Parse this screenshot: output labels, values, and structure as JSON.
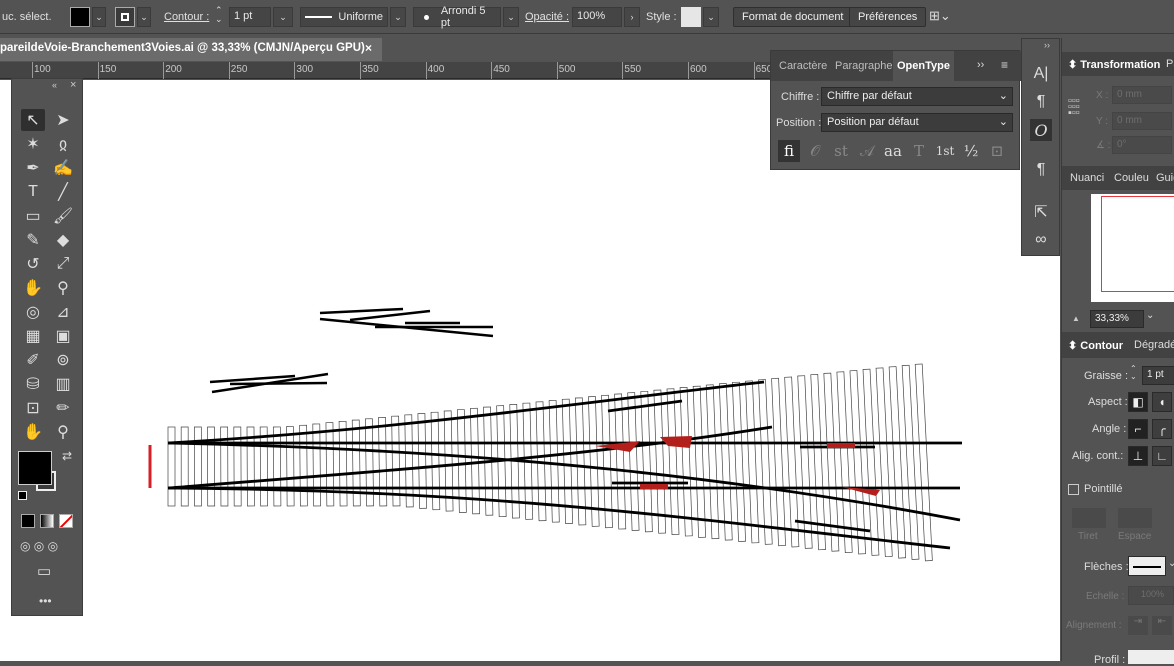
{
  "controlbar": {
    "selection_label": "uc. sélect.",
    "contour_label": "Contour :",
    "stroke_weight": "1 pt",
    "stroke_profile": "Uniforme",
    "brush": "Arrondi 5 pt",
    "opacity_label": "Opacité :",
    "opacity_value": "100%",
    "style_label": "Style :",
    "doc_format_button": "Format de document",
    "preferences_button": "Préférences"
  },
  "document": {
    "tab_title": "pareildeVoie-Branchement3Voies.ai @ 33,33% (CMJN/Aperçu GPU)",
    "close": "×"
  },
  "ruler": {
    "labels": [
      "100",
      "150",
      "200",
      "250",
      "300",
      "350",
      "400",
      "450",
      "500",
      "550",
      "600",
      "650"
    ]
  },
  "opentype_panel": {
    "tabs": [
      "Caractère",
      "Paragraphe",
      "OpenType"
    ],
    "chiffre_label": "Chiffre :",
    "chiffre_value": "Chiffre par défaut",
    "position_label": "Position :",
    "position_value": "Position par défaut",
    "glyphs": [
      "fi",
      "𝒪",
      "st",
      "𝒜",
      "aa",
      "T",
      "1st",
      "½",
      "⊡"
    ]
  },
  "right_panel": {
    "transformation_title": "Transformation",
    "transformation_tab2": "Pa",
    "x_label": "X :",
    "x_value": "0 mm",
    "y_label": "Y :",
    "y_value": "0 mm",
    "angle_label": "∡ :",
    "angle_value": "0°",
    "tabs2": [
      "Nuanci",
      "Couleu",
      "Guid"
    ],
    "zoom": "33,33%",
    "contour_title": "Contour",
    "degrade_tab": "Dégradé",
    "graisse_label": "Graisse :",
    "graisse_value": "1 pt",
    "aspect_label": "Aspect :",
    "angle2_label": "Angle :",
    "align_label": "Alig. cont.:",
    "pointille_label": "Pointillé",
    "tiret_label": "Tiret",
    "espace_label": "Espace",
    "fleches_label": "Flèches :",
    "echelle_label": "Echelle :",
    "echelle_value": "100%",
    "alignement_label": "Alignement :",
    "profil_label": "Profil :"
  },
  "colors": {
    "ui_bg": "#535353",
    "canvas": "#ffffff",
    "rail": "#000000",
    "frog_red": "#b3201c"
  }
}
